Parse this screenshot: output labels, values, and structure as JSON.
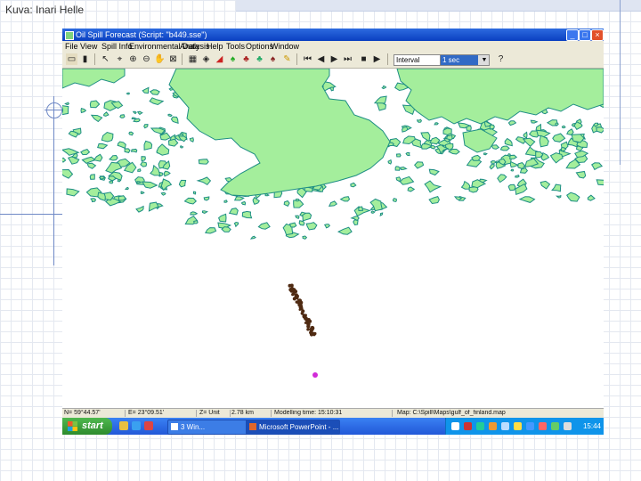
{
  "slide": {
    "credit": "Kuva: Inari Helle"
  },
  "window": {
    "title": "Oil Spill Forecast (Script: \"b449.sse\")",
    "controls": {
      "minimize": "_",
      "maximize": "□",
      "close": "×"
    }
  },
  "menu": [
    "File",
    "View",
    "Spill Info",
    "Environmental Data",
    "Analysis",
    "Help",
    "Tools",
    "Options",
    "Window",
    "Help"
  ],
  "toolbar": {
    "interval_label": "Interval",
    "interval_value": "1 sec"
  },
  "status": {
    "north": "N= 59°44.57'",
    "east": "E= 23°09.51'",
    "zoom": "Z= Unit",
    "distance": "2.78 km",
    "modelling": "Modelling time: 15:10:31",
    "map": "Map: C:\\Spill\\Maps\\gulf_of_finland.map"
  },
  "taskbar": {
    "start": "start",
    "tasks": [
      "3 Win...",
      "Microsoft PowerPoint - ..."
    ],
    "clock": "15:44"
  },
  "colors": {
    "land": "#a4ee9c",
    "coast": "#1e8e84",
    "oil": "#4f2a12",
    "accident": "#d12ad8"
  }
}
